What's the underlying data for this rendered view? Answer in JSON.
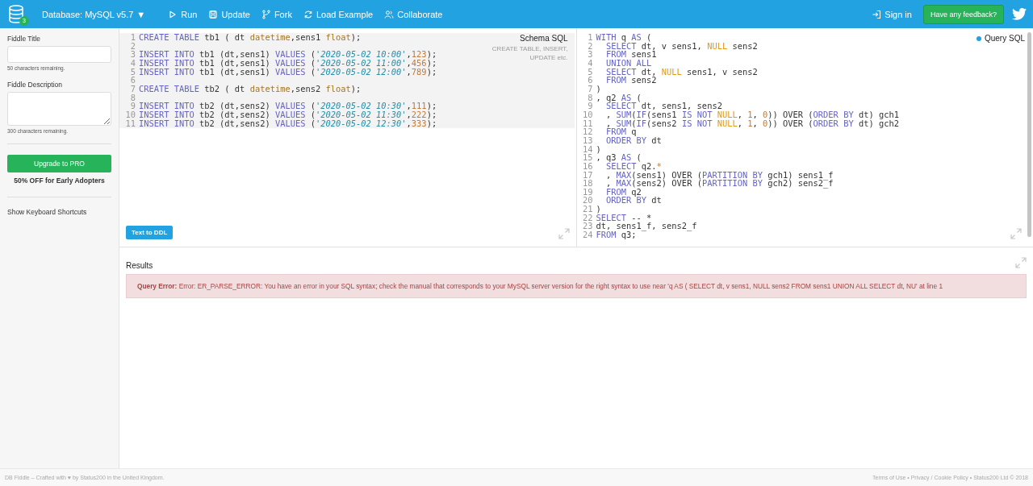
{
  "header": {
    "db_badge": "3",
    "database": "Database: MySQL v5.7",
    "database_caret": "▼",
    "actions": [
      {
        "kind": "run",
        "label": "Run"
      },
      {
        "kind": "update",
        "label": "Update"
      },
      {
        "kind": "fork",
        "label": "Fork"
      },
      {
        "kind": "load",
        "label": "Load Example"
      },
      {
        "kind": "collaborate",
        "label": "Collaborate"
      }
    ],
    "sign_in": "Sign in",
    "feedback": "Have any feedback?"
  },
  "sidebar": {
    "title_label": "Fiddle Title",
    "title_remaining": "50 characters remaining.",
    "description_label": "Fiddle Description",
    "description_remaining": "300 characters remaining.",
    "upgrade": "Upgrade to PRO",
    "offer": "50% OFF for Early Adopters",
    "shortcuts": "Show Keyboard Shortcuts"
  },
  "schema": {
    "title": "Schema SQL",
    "hint": "CREATE TABLE, INSERT, UPDATE etc.",
    "button": "Text to DDL",
    "lines": [
      {
        "number": "1",
        "tokens": [
          {
            "kind": "kw",
            "text": "CREATE TABLE"
          },
          {
            "kind": "plain",
            "text": " tb1 ( dt "
          },
          {
            "kind": "type",
            "text": "datetime"
          },
          {
            "kind": "plain",
            "text": ",sens1 "
          },
          {
            "kind": "type",
            "text": "float"
          },
          {
            "kind": "plain",
            "text": ");"
          }
        ]
      },
      {
        "number": "2"
      },
      {
        "number": "3",
        "tokens": [
          {
            "kind": "kw",
            "text": "INSERT INTO"
          },
          {
            "kind": "plain",
            "text": " tb1 (dt,sens1) "
          },
          {
            "kind": "kw",
            "text": "VALUES"
          },
          {
            "kind": "plain",
            "text": " ("
          },
          {
            "kind": "string",
            "text": "'2020-05-02 10:00'"
          },
          {
            "kind": "plain",
            "text": ","
          },
          {
            "kind": "number",
            "text": "123"
          },
          {
            "kind": "plain",
            "text": ");"
          }
        ]
      },
      {
        "number": "4",
        "tokens": [
          {
            "kind": "kw",
            "text": "INSERT INTO"
          },
          {
            "kind": "plain",
            "text": " tb1 (dt,sens1) "
          },
          {
            "kind": "kw",
            "text": "VALUES"
          },
          {
            "kind": "plain",
            "text": " ("
          },
          {
            "kind": "string",
            "text": "'2020-05-02 11:00'"
          },
          {
            "kind": "plain",
            "text": ","
          },
          {
            "kind": "number",
            "text": "456"
          },
          {
            "kind": "plain",
            "text": ");"
          }
        ]
      },
      {
        "number": "5",
        "tokens": [
          {
            "kind": "kw",
            "text": "INSERT INTO"
          },
          {
            "kind": "plain",
            "text": " tb1 (dt,sens1) "
          },
          {
            "kind": "kw",
            "text": "VALUES"
          },
          {
            "kind": "plain",
            "text": " ("
          },
          {
            "kind": "string",
            "text": "'2020-05-02 12:00'"
          },
          {
            "kind": "plain",
            "text": ","
          },
          {
            "kind": "number",
            "text": "789"
          },
          {
            "kind": "plain",
            "text": ");"
          }
        ]
      },
      {
        "number": "6"
      },
      {
        "number": "7",
        "tokens": [
          {
            "kind": "kw",
            "text": "CREATE TABLE"
          },
          {
            "kind": "plain",
            "text": " tb2 ( dt "
          },
          {
            "kind": "type",
            "text": "datetime"
          },
          {
            "kind": "plain",
            "text": ",sens2 "
          },
          {
            "kind": "type",
            "text": "float"
          },
          {
            "kind": "plain",
            "text": ");"
          }
        ]
      },
      {
        "number": "8"
      },
      {
        "number": "9",
        "tokens": [
          {
            "kind": "kw",
            "text": "INSERT INTO"
          },
          {
            "kind": "plain",
            "text": " tb2 (dt,sens2) "
          },
          {
            "kind": "kw",
            "text": "VALUES"
          },
          {
            "kind": "plain",
            "text": " ("
          },
          {
            "kind": "string",
            "text": "'2020-05-02 10:30'"
          },
          {
            "kind": "plain",
            "text": ","
          },
          {
            "kind": "number",
            "text": "111"
          },
          {
            "kind": "plain",
            "text": ");"
          }
        ]
      },
      {
        "number": "10",
        "tokens": [
          {
            "kind": "kw",
            "text": "INSERT INTO"
          },
          {
            "kind": "plain",
            "text": " tb2 (dt,sens2) "
          },
          {
            "kind": "kw",
            "text": "VALUES"
          },
          {
            "kind": "plain",
            "text": " ("
          },
          {
            "kind": "string",
            "text": "'2020-05-02 11:30'"
          },
          {
            "kind": "plain",
            "text": ","
          },
          {
            "kind": "number",
            "text": "222"
          },
          {
            "kind": "plain",
            "text": ");"
          }
        ]
      },
      {
        "number": "11",
        "tokens": [
          {
            "kind": "kw",
            "text": "INSERT INTO"
          },
          {
            "kind": "plain",
            "text": " tb2 (dt,sens2) "
          },
          {
            "kind": "kw",
            "text": "VALUES"
          },
          {
            "kind": "plain",
            "text": " ("
          },
          {
            "kind": "string",
            "text": "'2020-05-02 12:30'"
          },
          {
            "kind": "plain",
            "text": ","
          },
          {
            "kind": "number",
            "text": "333"
          },
          {
            "kind": "plain",
            "text": ");"
          }
        ]
      }
    ]
  },
  "query": {
    "title": "Query SQL",
    "lines": [
      {
        "number": "1",
        "tokens": [
          {
            "kind": "kw",
            "text": "WITH"
          },
          {
            "kind": "plain",
            "text": " q "
          },
          {
            "kind": "kw",
            "text": "AS"
          },
          {
            "kind": "plain",
            "text": " ("
          }
        ]
      },
      {
        "number": "2",
        "tokens": [
          {
            "kind": "kw",
            "text": "  SELECT"
          },
          {
            "kind": "plain",
            "text": " dt, v sens1, "
          },
          {
            "kind": "null",
            "text": "NULL"
          },
          {
            "kind": "plain",
            "text": " sens2"
          }
        ]
      },
      {
        "number": "3",
        "tokens": [
          {
            "kind": "kw",
            "text": "  FROM"
          },
          {
            "kind": "plain",
            "text": " sens1"
          }
        ]
      },
      {
        "number": "4",
        "tokens": [
          {
            "kind": "kw",
            "text": "  UNION ALL"
          }
        ]
      },
      {
        "number": "5",
        "tokens": [
          {
            "kind": "kw",
            "text": "  SELECT"
          },
          {
            "kind": "plain",
            "text": " dt, "
          },
          {
            "kind": "null",
            "text": "NULL"
          },
          {
            "kind": "plain",
            "text": " sens1, v sens2"
          }
        ]
      },
      {
        "number": "6",
        "tokens": [
          {
            "kind": "kw",
            "text": "  FROM"
          },
          {
            "kind": "plain",
            "text": " sens2"
          }
        ]
      },
      {
        "number": "7",
        "tokens": [
          {
            "kind": "plain",
            "text": ")"
          }
        ]
      },
      {
        "number": "8",
        "tokens": [
          {
            "kind": "plain",
            "text": ", q2 "
          },
          {
            "kind": "kw",
            "text": "AS"
          },
          {
            "kind": "plain",
            "text": " ("
          }
        ]
      },
      {
        "number": "9",
        "tokens": [
          {
            "kind": "kw",
            "text": "  SELECT"
          },
          {
            "kind": "plain",
            "text": " dt, sens1, sens2"
          }
        ]
      },
      {
        "number": "10",
        "tokens": [
          {
            "kind": "plain",
            "text": "  , "
          },
          {
            "kind": "kw",
            "text": "SUM"
          },
          {
            "kind": "plain",
            "text": "("
          },
          {
            "kind": "kw",
            "text": "IF"
          },
          {
            "kind": "plain",
            "text": "(sens1 "
          },
          {
            "kind": "kw",
            "text": "IS NOT "
          },
          {
            "kind": "null",
            "text": "NULL"
          },
          {
            "kind": "plain",
            "text": ", "
          },
          {
            "kind": "number",
            "text": "1"
          },
          {
            "kind": "plain",
            "text": ", "
          },
          {
            "kind": "number",
            "text": "0"
          },
          {
            "kind": "plain",
            "text": ")) OVER ("
          },
          {
            "kind": "kw",
            "text": "ORDER BY"
          },
          {
            "kind": "plain",
            "text": " dt) gch1"
          }
        ]
      },
      {
        "number": "11",
        "tokens": [
          {
            "kind": "plain",
            "text": "  , "
          },
          {
            "kind": "kw",
            "text": "SUM"
          },
          {
            "kind": "plain",
            "text": "("
          },
          {
            "kind": "kw",
            "text": "IF"
          },
          {
            "kind": "plain",
            "text": "(sens2 "
          },
          {
            "kind": "kw",
            "text": "IS NOT "
          },
          {
            "kind": "null",
            "text": "NULL"
          },
          {
            "kind": "plain",
            "text": ", "
          },
          {
            "kind": "number",
            "text": "1"
          },
          {
            "kind": "plain",
            "text": ", "
          },
          {
            "kind": "number",
            "text": "0"
          },
          {
            "kind": "plain",
            "text": ")) OVER ("
          },
          {
            "kind": "kw",
            "text": "ORDER BY"
          },
          {
            "kind": "plain",
            "text": " dt) gch2"
          }
        ]
      },
      {
        "number": "12",
        "tokens": [
          {
            "kind": "kw",
            "text": "  FROM"
          },
          {
            "kind": "plain",
            "text": " q"
          }
        ]
      },
      {
        "number": "13",
        "tokens": [
          {
            "kind": "kw",
            "text": "  ORDER BY"
          },
          {
            "kind": "plain",
            "text": " dt"
          }
        ]
      },
      {
        "number": "14",
        "tokens": [
          {
            "kind": "plain",
            "text": ")"
          }
        ]
      },
      {
        "number": "15",
        "tokens": [
          {
            "kind": "plain",
            "text": ", q3 "
          },
          {
            "kind": "kw",
            "text": "AS"
          },
          {
            "kind": "plain",
            "text": " ("
          }
        ]
      },
      {
        "number": "16",
        "tokens": [
          {
            "kind": "kw",
            "text": "  SELECT"
          },
          {
            "kind": "plain",
            "text": " q2."
          },
          {
            "kind": "number",
            "text": "*"
          }
        ]
      },
      {
        "number": "17",
        "tokens": [
          {
            "kind": "plain",
            "text": "  , "
          },
          {
            "kind": "kw",
            "text": "MAX"
          },
          {
            "kind": "plain",
            "text": "(sens1) OVER ("
          },
          {
            "kind": "kw",
            "text": "PARTITION BY"
          },
          {
            "kind": "plain",
            "text": " gch1) sens1_f"
          }
        ]
      },
      {
        "number": "18",
        "tokens": [
          {
            "kind": "plain",
            "text": "  , "
          },
          {
            "kind": "kw",
            "text": "MAX"
          },
          {
            "kind": "plain",
            "text": "(sens2) OVER ("
          },
          {
            "kind": "kw",
            "text": "PARTITION BY"
          },
          {
            "kind": "plain",
            "text": " gch2) sens2_f"
          }
        ]
      },
      {
        "number": "19",
        "tokens": [
          {
            "kind": "kw",
            "text": "  FROM"
          },
          {
            "kind": "plain",
            "text": " q2"
          }
        ]
      },
      {
        "number": "20",
        "tokens": [
          {
            "kind": "kw",
            "text": "  ORDER BY"
          },
          {
            "kind": "plain",
            "text": " dt"
          }
        ]
      },
      {
        "number": "21",
        "tokens": [
          {
            "kind": "plain",
            "text": ")"
          }
        ]
      },
      {
        "number": "22",
        "tokens": [
          {
            "kind": "kw",
            "text": "SELECT"
          },
          {
            "kind": "plain",
            "text": " -- *"
          }
        ]
      },
      {
        "number": "23",
        "tokens": [
          {
            "kind": "plain",
            "text": "dt, sens1_f, sens2_f"
          }
        ]
      },
      {
        "number": "24",
        "tokens": [
          {
            "kind": "kw",
            "text": "FROM"
          },
          {
            "kind": "plain",
            "text": " q3;"
          }
        ]
      }
    ]
  },
  "results": {
    "title": "Results",
    "error_label": "Query Error:",
    "error_text": "Error: ER_PARSE_ERROR: You have an error in your SQL syntax; check the manual that corresponds to your MySQL server version for the right syntax to use near 'q AS ( SELECT dt, v sens1, NULL sens2 FROM sens1 UNION ALL SELECT dt, NU' at line 1"
  },
  "footer": {
    "left": "DB Fiddle – Crafted with ♥ by Status200 in the United Kingdom.",
    "right": "Terms of Use • Privacy / Cookie Policy • Status200 Ltd © 2018"
  }
}
